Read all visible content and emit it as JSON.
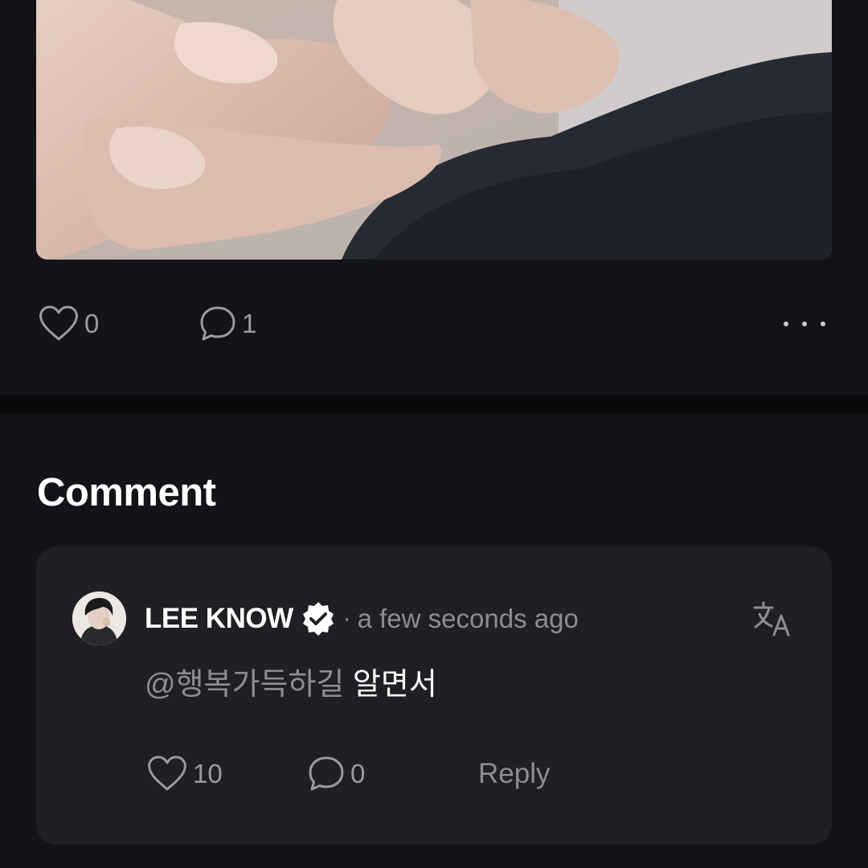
{
  "post": {
    "image_alt": "hands-photo",
    "like_count": "0",
    "comment_count": "1"
  },
  "section": {
    "title": "Comment"
  },
  "comment": {
    "author": "LEE KNOW",
    "verified": true,
    "separator": "·",
    "timestamp": "a few seconds ago",
    "mention": "@행복가득하길",
    "text": "알면서",
    "like_count": "10",
    "reply_count": "0",
    "reply_label": "Reply"
  },
  "icons": {
    "like": "heart-icon",
    "comment": "speech-bubble-icon",
    "more": "more-dots-icon",
    "translate": "translate-icon",
    "verified": "verified-badge-icon"
  },
  "colors": {
    "background": "#141318",
    "card": "#201f24",
    "muted_text": "#8d8d93",
    "divider": "#0a090c"
  }
}
